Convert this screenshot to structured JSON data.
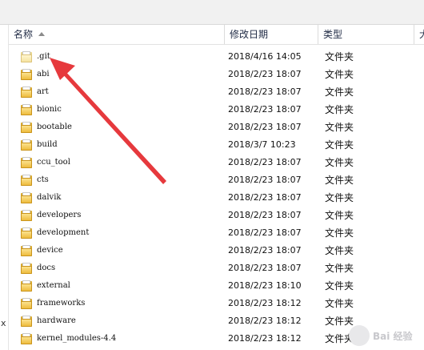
{
  "header": {
    "name": "名称",
    "date": "修改日期",
    "type": "类型",
    "size": "大"
  },
  "left_pane_text": "x",
  "icons": {
    "folder": "folder-icon",
    "sort": "sort-ascending-icon",
    "annotation": "red-arrow-annotation",
    "watermark": "baidu-jingyan-watermark"
  },
  "colors": {
    "arrow": "#e6393d",
    "folder": "#eebc3e"
  },
  "files": [
    {
      "name": ".git",
      "date": "2018/4/16 14:05",
      "type": "文件夹"
    },
    {
      "name": "abi",
      "date": "2018/2/23 18:07",
      "type": "文件夹"
    },
    {
      "name": "art",
      "date": "2018/2/23 18:07",
      "type": "文件夹"
    },
    {
      "name": "bionic",
      "date": "2018/2/23 18:07",
      "type": "文件夹"
    },
    {
      "name": "bootable",
      "date": "2018/2/23 18:07",
      "type": "文件夹"
    },
    {
      "name": "build",
      "date": "2018/3/7 10:23",
      "type": "文件夹"
    },
    {
      "name": "ccu_tool",
      "date": "2018/2/23 18:07",
      "type": "文件夹"
    },
    {
      "name": "cts",
      "date": "2018/2/23 18:07",
      "type": "文件夹"
    },
    {
      "name": "dalvik",
      "date": "2018/2/23 18:07",
      "type": "文件夹"
    },
    {
      "name": "developers",
      "date": "2018/2/23 18:07",
      "type": "文件夹"
    },
    {
      "name": "development",
      "date": "2018/2/23 18:07",
      "type": "文件夹"
    },
    {
      "name": "device",
      "date": "2018/2/23 18:07",
      "type": "文件夹"
    },
    {
      "name": "docs",
      "date": "2018/2/23 18:07",
      "type": "文件夹"
    },
    {
      "name": "external",
      "date": "2018/2/23 18:10",
      "type": "文件夹"
    },
    {
      "name": "frameworks",
      "date": "2018/2/23 18:12",
      "type": "文件夹"
    },
    {
      "name": "hardware",
      "date": "2018/2/23 18:12",
      "type": "文件夹"
    },
    {
      "name": "kernel_modules-4.4",
      "date": "2018/2/23 18:12",
      "type": "文件夹"
    }
  ]
}
